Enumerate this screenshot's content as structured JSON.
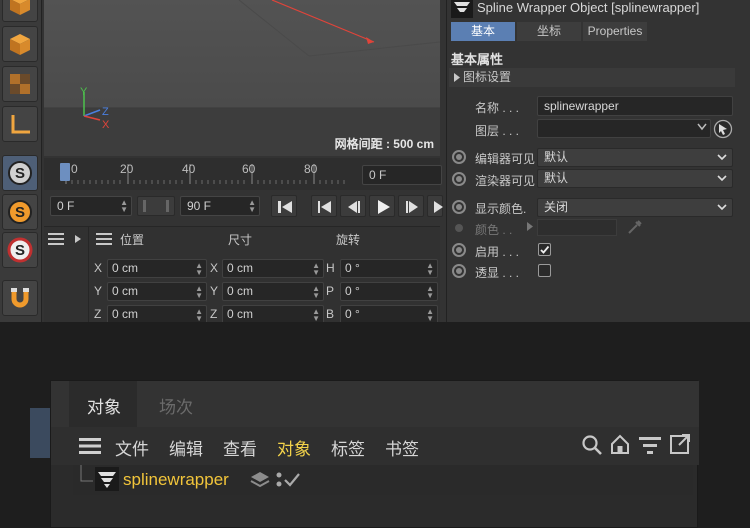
{
  "viewport": {
    "axis_x": "X",
    "axis_y": "Y",
    "axis_z": "Z",
    "grid_spacing": "网格间距 : 500 cm"
  },
  "timeline": {
    "ticks": [
      "0",
      "20",
      "40",
      "60",
      "80"
    ],
    "current_frame": "0 F"
  },
  "transport": {
    "start_frame": "0 F",
    "end_frame": "90 F"
  },
  "coords": {
    "headers": {
      "position": "位置",
      "size": "尺寸",
      "rotation": "旋转"
    },
    "rows": [
      {
        "pos_axis": "X",
        "pos": "0 cm",
        "size_axis": "X",
        "size": "0 cm",
        "rot_axis": "H",
        "rot": "0 °"
      },
      {
        "pos_axis": "Y",
        "pos": "0 cm",
        "size_axis": "Y",
        "size": "0 cm",
        "rot_axis": "P",
        "rot": "0 °"
      },
      {
        "pos_axis": "Z",
        "pos": "0 cm",
        "size_axis": "Z",
        "size": "0 cm",
        "rot_axis": "B",
        "rot": "0 °"
      }
    ]
  },
  "attributes": {
    "title": "Spline Wrapper Object [splinewrapper]",
    "tabs": [
      "基本",
      "坐标",
      "Properties"
    ],
    "section": "基本属性",
    "subsection": "图标设置",
    "name_label": "名称 . . .",
    "name_value": "splinewrapper",
    "layer_label": "图层 . . .",
    "editor_visible_label": "编辑器可见",
    "editor_visible_value": "默认",
    "render_visible_label": "渲染器可见",
    "render_visible_value": "默认",
    "display_color_label": "显示颜色.",
    "display_color_value": "关闭",
    "color_label": "颜色 . .",
    "enabled_label": "启用 . . .",
    "transparency_label": "透显 . . ."
  },
  "object_manager": {
    "tabs": [
      "对象",
      "场次"
    ],
    "menu": [
      "文件",
      "编辑",
      "查看",
      "对象",
      "标签",
      "书签"
    ],
    "item": "splinewrapper"
  },
  "colors": {
    "accent_blue": "#5b7fb3",
    "highlight_yellow": "#f2d24a",
    "item_orange": "#f2c53a",
    "axis_red": "#e0443a",
    "axis_green": "#4cc24c",
    "axis_blue": "#4a7fe0"
  }
}
